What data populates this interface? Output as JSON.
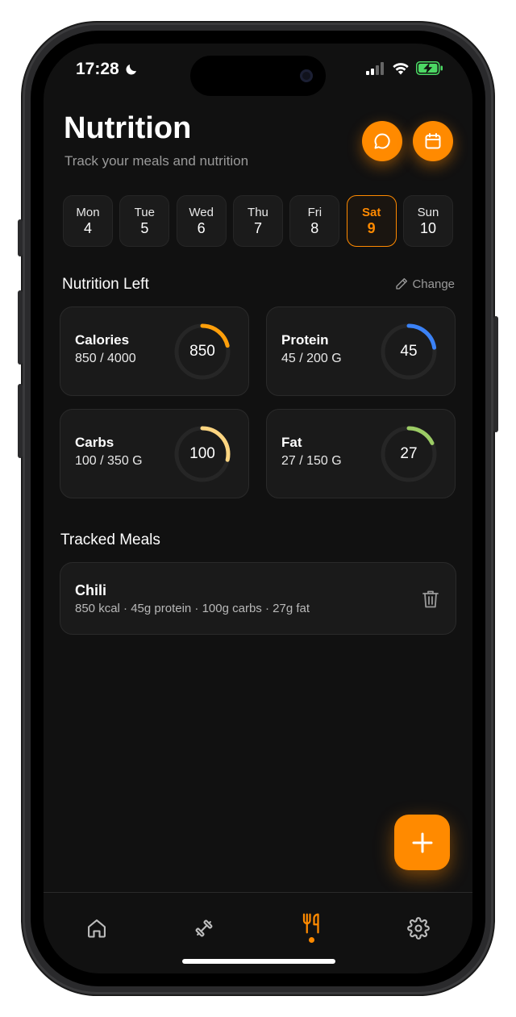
{
  "status": {
    "time": "17:28"
  },
  "header": {
    "title": "Nutrition",
    "subtitle": "Track your meals and nutrition"
  },
  "days": [
    {
      "name": "Mon",
      "num": "4",
      "active": false
    },
    {
      "name": "Tue",
      "num": "5",
      "active": false
    },
    {
      "name": "Wed",
      "num": "6",
      "active": false
    },
    {
      "name": "Thu",
      "num": "7",
      "active": false
    },
    {
      "name": "Fri",
      "num": "8",
      "active": false
    },
    {
      "name": "Sat",
      "num": "9",
      "active": true
    },
    {
      "name": "Sun",
      "num": "10",
      "active": false
    }
  ],
  "nutrition": {
    "section_title": "Nutrition Left",
    "change_label": "Change",
    "cards": [
      {
        "label": "Calories",
        "value": "850 / 4000",
        "ring_number": "850",
        "progress": 0.2125,
        "color": "#ff9f0a"
      },
      {
        "label": "Protein",
        "value": "45 / 200 G",
        "ring_number": "45",
        "progress": 0.225,
        "color": "#3b82f6"
      },
      {
        "label": "Carbs",
        "value": "100 / 350 G",
        "ring_number": "100",
        "progress": 0.286,
        "color": "#fcd581"
      },
      {
        "label": "Fat",
        "value": "27 / 150 G",
        "ring_number": "27",
        "progress": 0.18,
        "color": "#9ccc65"
      }
    ]
  },
  "meals": {
    "section_title": "Tracked Meals",
    "items": [
      {
        "name": "Chili",
        "info": "850 kcal · 45g protein · 100g carbs · 27g fat"
      }
    ]
  },
  "colors": {
    "accent": "#ff8a00",
    "background": "#111111",
    "card": "#1a1a1a"
  },
  "tabs": [
    {
      "icon": "home-icon",
      "active": false
    },
    {
      "icon": "dumbbell-icon",
      "active": false
    },
    {
      "icon": "fork-knife-icon",
      "active": true
    },
    {
      "icon": "gear-icon",
      "active": false
    }
  ]
}
